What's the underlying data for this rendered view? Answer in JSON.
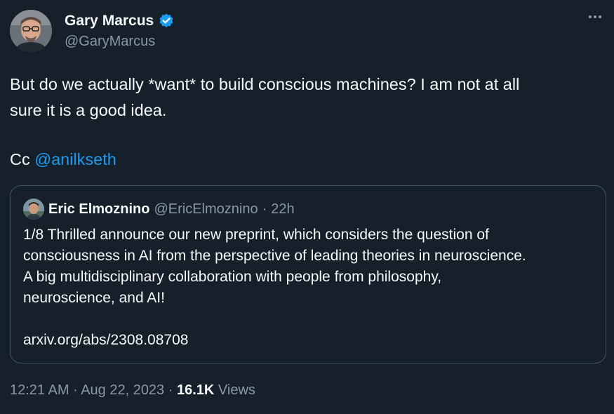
{
  "author": {
    "display_name": "Gary Marcus",
    "handle": "@GaryMarcus",
    "avatar_icon": "person-avatar-icon",
    "verified_icon": "verified-badge-icon"
  },
  "menu_icon": "more-options-icon",
  "tweet": {
    "line1": "But do we actually *want* to build conscious machines? I am not at all",
    "line2": "sure it is a good idea.",
    "cc_prefix": "Cc ",
    "mention": "@anilkseth"
  },
  "quoted": {
    "display_name": "Eric Elmoznino",
    "handle": "@EricElmoznino",
    "separator": "·",
    "time": "22h",
    "lines": [
      "1/8 Thrilled announce our new preprint, which considers the question of",
      "consciousness in AI from the perspective of leading theories in neuroscience.",
      "A big multidisciplinary collaboration with people from philosophy,",
      "neuroscience, and AI!"
    ],
    "link": "arxiv.org/abs/2308.08708"
  },
  "footer": {
    "time": "12:21 AM",
    "sep1": " · ",
    "date": "Aug 22, 2023",
    "sep2": " · ",
    "views_count": "16.1K",
    "views_label": " Views"
  },
  "colors": {
    "background": "#15202b",
    "text": "#f7f9f9",
    "secondary": "#8b98a5",
    "accent": "#1d9bf0",
    "border": "#425364"
  }
}
